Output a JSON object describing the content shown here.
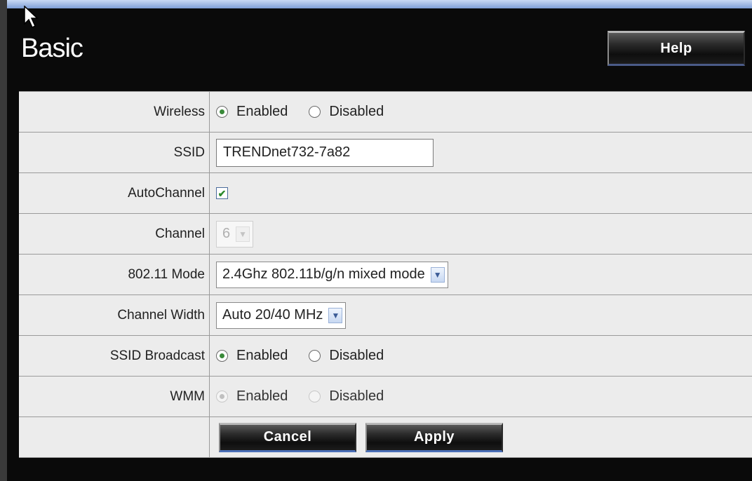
{
  "header": {
    "title": "Basic",
    "help_label": "Help"
  },
  "form": {
    "wireless": {
      "label": "Wireless",
      "options": [
        "Enabled",
        "Disabled"
      ],
      "selected": "Enabled"
    },
    "ssid": {
      "label": "SSID",
      "value": "TRENDnet732-7a82"
    },
    "autochannel": {
      "label": "AutoChannel",
      "checked": true
    },
    "channel": {
      "label": "Channel",
      "value": "6",
      "disabled": true
    },
    "mode": {
      "label": "802.11 Mode",
      "value": "2.4Ghz 802.11b/g/n mixed mode"
    },
    "channel_width": {
      "label": "Channel Width",
      "value": "Auto 20/40 MHz"
    },
    "ssid_broadcast": {
      "label": "SSID Broadcast",
      "options": [
        "Enabled",
        "Disabled"
      ],
      "selected": "Enabled"
    },
    "wmm": {
      "label": "WMM",
      "options": [
        "Enabled",
        "Disabled"
      ],
      "selected": "Enabled",
      "disabled": true
    }
  },
  "actions": {
    "cancel_label": "Cancel",
    "apply_label": "Apply"
  },
  "colors": {
    "background": "#0a0a0a",
    "form_bg": "#ececec",
    "check_green": "#2c8a2c"
  }
}
